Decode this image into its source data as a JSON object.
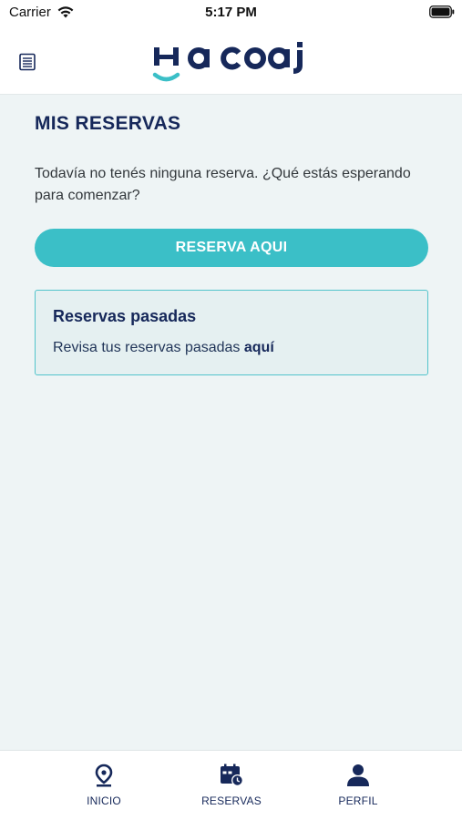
{
  "status_bar": {
    "carrier": "Carrier",
    "time": "5:17 PM"
  },
  "header": {
    "logo_text": "Hacoaj",
    "menu_icon": "document-list-icon"
  },
  "main": {
    "title": "MIS RESERVAS",
    "empty_message": "Todavía no tenés ninguna reserva. ¿Qué estás esperando para comenzar?",
    "reserve_button_label": "RESERVA AQUI",
    "past_card": {
      "title": "Reservas pasadas",
      "text": "Revisa tus reservas pasadas ",
      "link": "aquí"
    }
  },
  "tab_bar": {
    "items": [
      {
        "label": "INICIO",
        "icon": "location-pin-icon"
      },
      {
        "label": "RESERVAS",
        "icon": "calendar-clock-icon"
      },
      {
        "label": "PERFIL",
        "icon": "person-icon"
      }
    ]
  },
  "colors": {
    "navy": "#16285a",
    "accent": "#3bbfc7",
    "background": "#eef4f5"
  }
}
